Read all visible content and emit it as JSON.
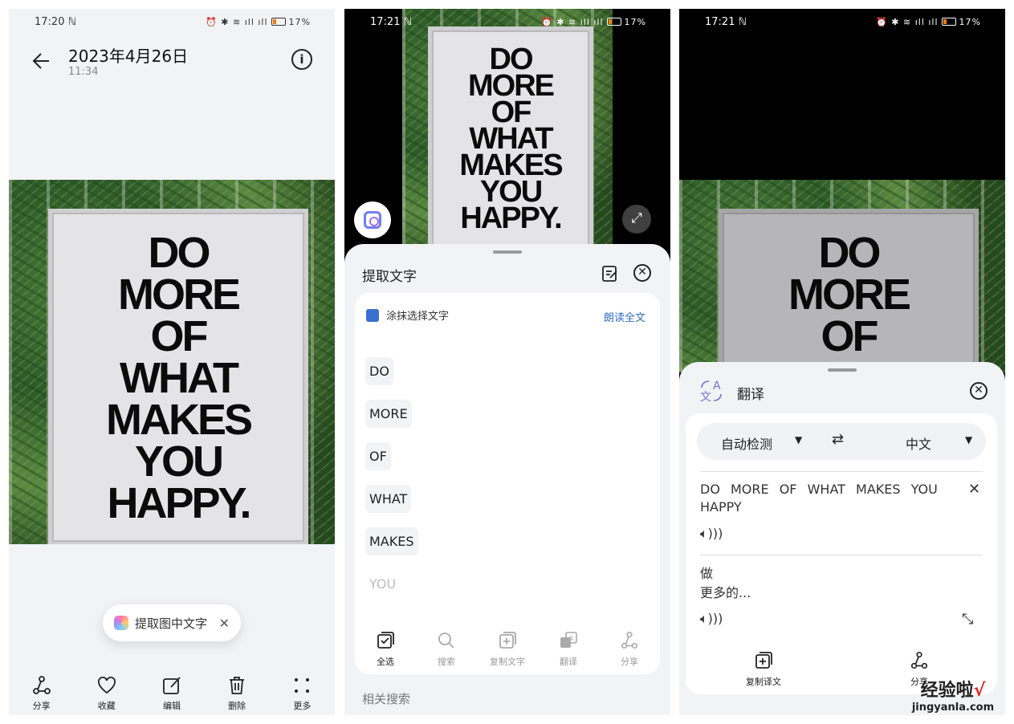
{
  "panel1": {
    "status": {
      "time": "17:20 ℕ",
      "battery": "17%"
    },
    "header": {
      "date": "2023年4月26日",
      "time": "11:34"
    },
    "poster_lines": [
      "DO",
      "MORE",
      "OF",
      "WHAT",
      "MAKES",
      "YOU",
      "HAPPY."
    ],
    "chip": {
      "label": "提取图中文字"
    },
    "toolbar": [
      {
        "label": "分享",
        "icon": "share-icon"
      },
      {
        "label": "收藏",
        "icon": "heart-icon"
      },
      {
        "label": "编辑",
        "icon": "edit-icon"
      },
      {
        "label": "删除",
        "icon": "trash-icon"
      },
      {
        "label": "更多",
        "icon": "more-icon"
      }
    ]
  },
  "panel2": {
    "status": {
      "time": "17:21 ℕ",
      "battery": "17%"
    },
    "sheet_title": "提取文字",
    "card_head": "涂抹选择文字",
    "read_all": "朗读全文",
    "words": [
      "DO",
      "MORE",
      "OF",
      "WHAT",
      "MAKES",
      "YOU"
    ],
    "tools": [
      {
        "label": "全选",
        "icon": "select-all-icon"
      },
      {
        "label": "搜索",
        "icon": "search-icon"
      },
      {
        "label": "复制文字",
        "icon": "copy-icon"
      },
      {
        "label": "翻译",
        "icon": "translate-icon"
      },
      {
        "label": "分享",
        "icon": "share-icon"
      }
    ],
    "related": "相关搜索"
  },
  "panel3": {
    "status": {
      "time": "17:21 ℕ",
      "battery": "17%"
    },
    "title": "翻译",
    "source_lang": "自动检测",
    "target_lang": "中文",
    "source_text": "DO MORE OF WHAT MAKES YOU HAPPY",
    "target_text_line1": "做",
    "target_text_line2": "更多的...",
    "tools": [
      {
        "label": "复制译文",
        "icon": "copy-icon"
      },
      {
        "label": "分享",
        "icon": "share-icon"
      }
    ]
  },
  "watermark": {
    "cn": "经验啦",
    "en": "jingyanla.com"
  }
}
